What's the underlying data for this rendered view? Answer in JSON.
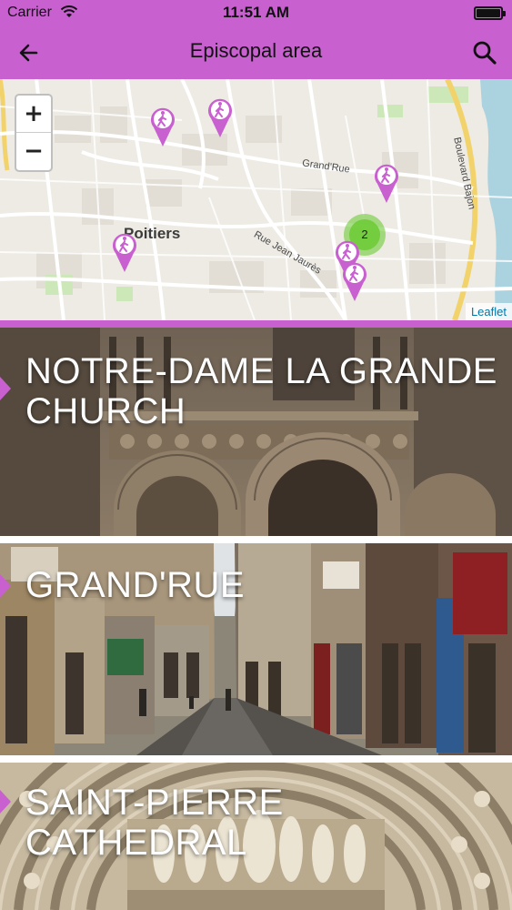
{
  "status_bar": {
    "carrier": "Carrier",
    "time": "11:51 AM",
    "wifi_icon": "wifi-icon",
    "battery_icon": "battery-icon"
  },
  "nav": {
    "title": "Episcopal area",
    "back_icon": "arrow-left-icon",
    "search_icon": "search-icon"
  },
  "map": {
    "zoom_in_label": "+",
    "zoom_out_label": "−",
    "city_label": "Poitiers",
    "streets": [
      "Grand'Rue",
      "Rue Jean Jaurès",
      "Boulevard Bajon"
    ],
    "cluster_count": "2",
    "attribution": "Leaflet",
    "marker_icon": "pedestrian-marker-icon",
    "marker_color": "#c860d0",
    "cluster_color": "#6ecc39"
  },
  "places": [
    {
      "title": "NOTRE-DAME LA GRANDE CHURCH"
    },
    {
      "title": "GRAND'RUE"
    },
    {
      "title": "SAINT-PIERRE CATHEDRAL"
    }
  ],
  "theme": {
    "accent": "#c860d0"
  }
}
